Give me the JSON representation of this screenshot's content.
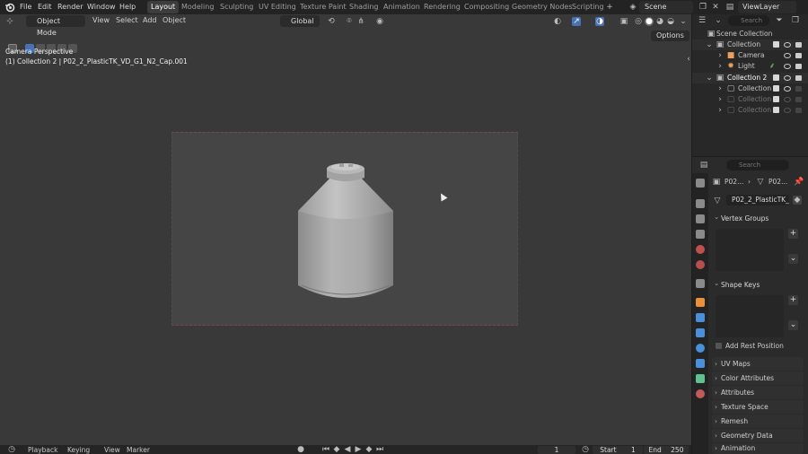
{
  "menu": [
    "File",
    "Edit",
    "Render",
    "Window",
    "Help"
  ],
  "workspaces": [
    "Layout",
    "Modeling",
    "Sculpting",
    "UV Editing",
    "Texture Paint",
    "Shading",
    "Animation",
    "Rendering",
    "Compositing",
    "Geometry Nodes",
    "Scripting"
  ],
  "scene": "Scene",
  "view_layer": "ViewLayer",
  "viewport": {
    "mode": "Object Mode",
    "menus": [
      "View",
      "Select",
      "Add",
      "Object"
    ],
    "transform_orientation": "Global",
    "options_label": "Options",
    "info_line1": "Camera Perspective",
    "info_line2": "(1) Collection 2 | P02_2_PlasticTK_VD_G1_N2_Cap.001"
  },
  "outliner": {
    "search_placeholder": "Search",
    "rows": [
      {
        "label": "Scene Collection"
      },
      {
        "label": "Collection"
      },
      {
        "label": "Camera"
      },
      {
        "label": "Light"
      },
      {
        "label": "Collection 2"
      },
      {
        "label": "Collection"
      },
      {
        "label": "Collection"
      },
      {
        "label": "Collection"
      }
    ]
  },
  "properties": {
    "search_placeholder": "Search",
    "breadcrumb_a": "P02...",
    "breadcrumb_b": "P02...",
    "mesh_name": "P02_2_PlasticTK_...",
    "vertex_groups": "Vertex Groups",
    "shape_keys": "Shape Keys",
    "add_rest_position": "Add Rest Position",
    "sections": [
      "UV Maps",
      "Color Attributes",
      "Attributes",
      "Texture Space",
      "Remesh",
      "Geometry Data",
      "Animation"
    ]
  },
  "timeline": {
    "menus": [
      "Playback",
      "Keying",
      "View",
      "Marker"
    ],
    "current_frame": "1",
    "start_label": "Start",
    "start_value": "1",
    "end_label": "End",
    "end_value": "250"
  },
  "colors": {
    "accent": "#4772b3",
    "viewport_bg": "#393939",
    "camera_frame_bg": "#454545",
    "object": "#a6a6a6"
  }
}
